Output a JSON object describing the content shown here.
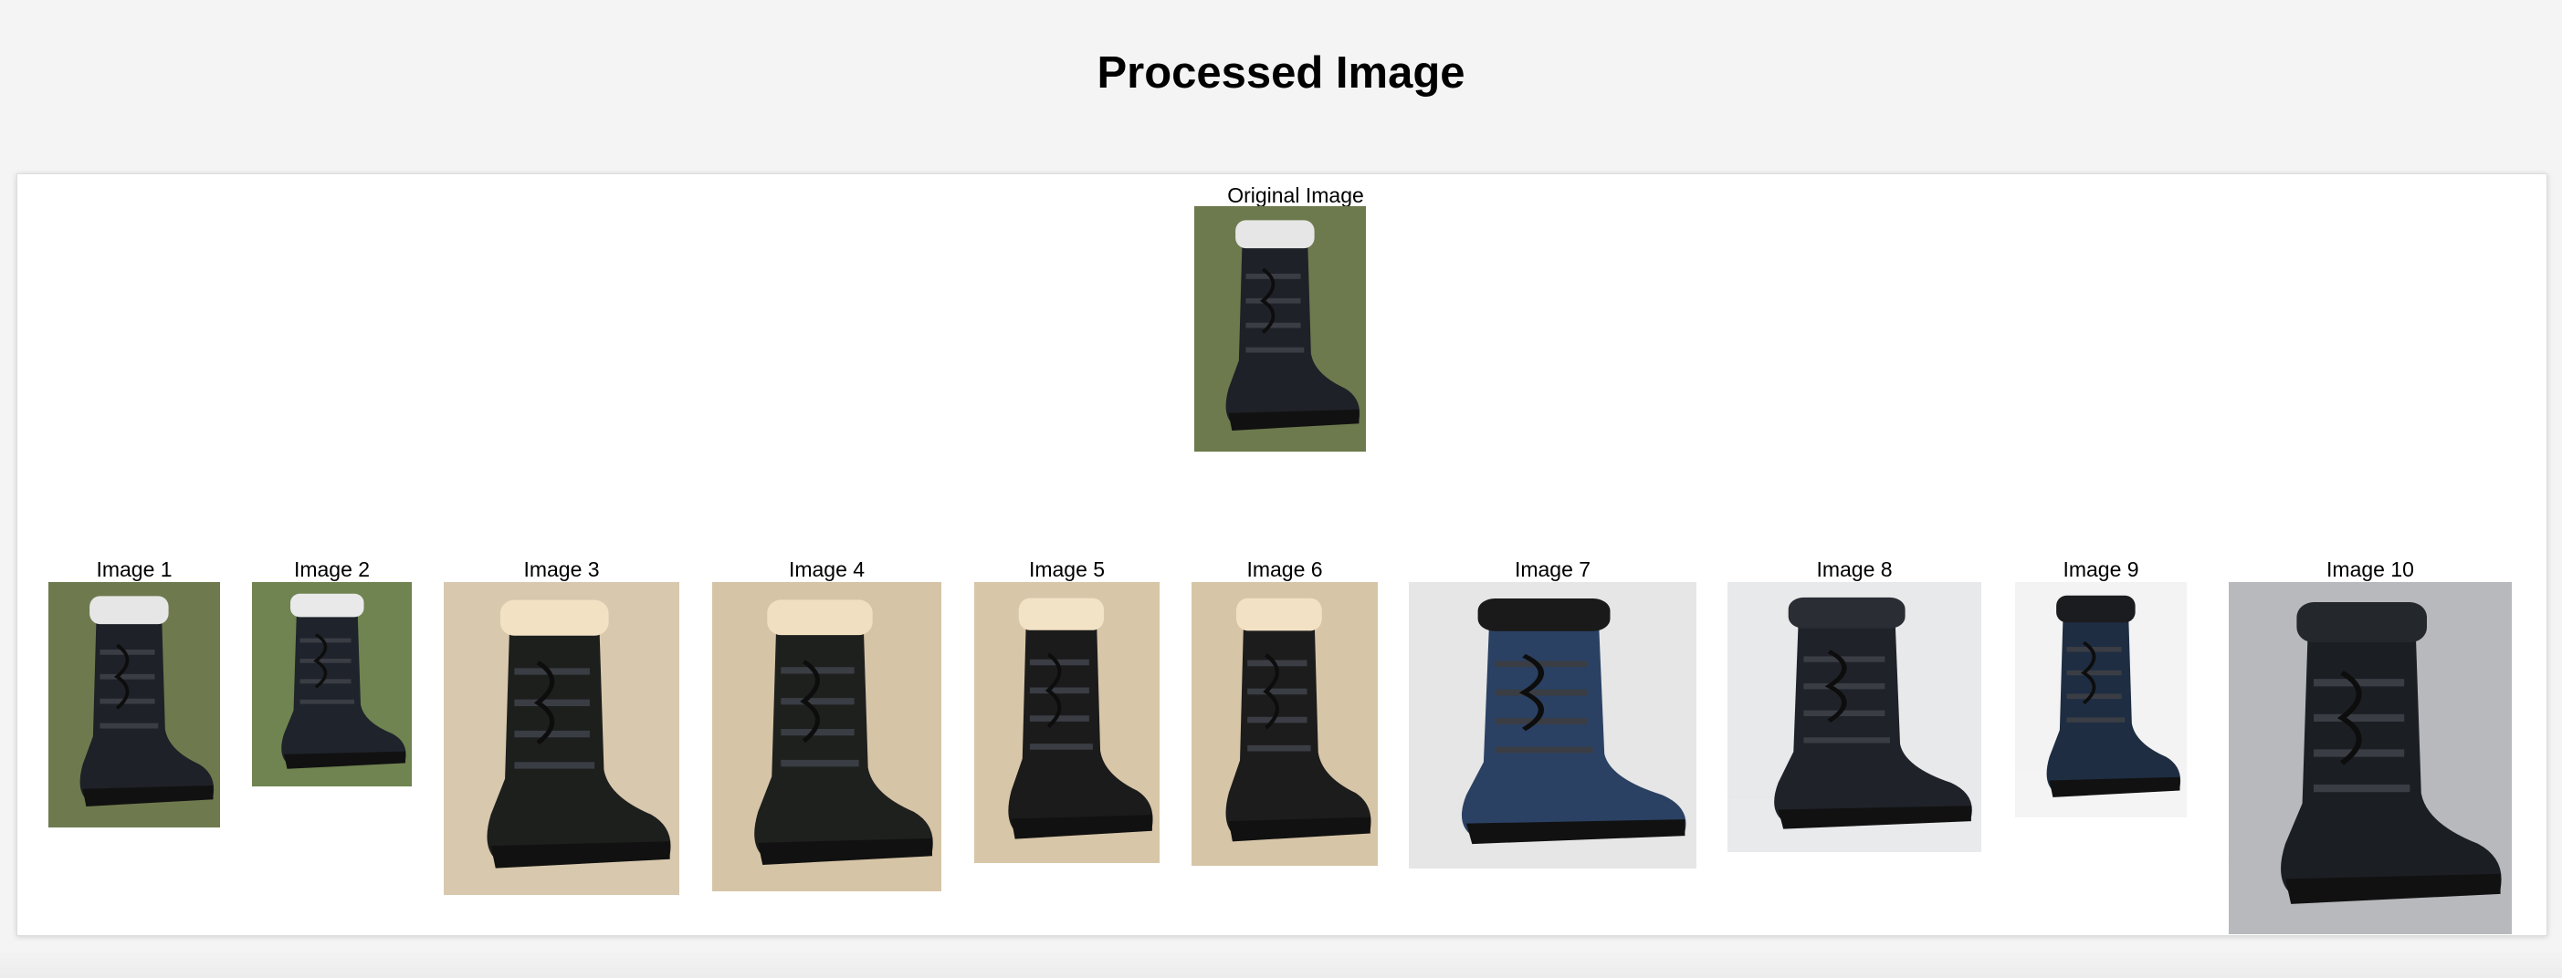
{
  "page": {
    "title": "Processed Image"
  },
  "original": {
    "caption": "Original Image",
    "icon": "boot-photo"
  },
  "results": [
    {
      "caption": "Image 1",
      "bg": "#6e7a4e",
      "boot": "#1e2127",
      "fur": "#e6e6e6",
      "icon": "boot-photo"
    },
    {
      "caption": "Image 2",
      "bg": "#6f8450",
      "boot": "#1f232b",
      "fur": "#e9e9e9",
      "icon": "boot-photo"
    },
    {
      "caption": "Image 3",
      "bg": "#d8c8ad",
      "boot": "#1d1f1d",
      "fur": "#f2e1c3",
      "icon": "boot-photo"
    },
    {
      "caption": "Image 4",
      "bg": "#d6c4a6",
      "boot": "#1e201e",
      "fur": "#f1dfc1",
      "icon": "boot-photo"
    },
    {
      "caption": "Image 5",
      "bg": "#d8c6a8",
      "boot": "#1b1b1b",
      "fur": "#f2e2c6",
      "icon": "boot-photo"
    },
    {
      "caption": "Image 6",
      "bg": "#d7c5a7",
      "boot": "#1c1c1c",
      "fur": "#f2e1c4",
      "icon": "boot-photo"
    },
    {
      "caption": "Image 7",
      "bg": "#e6e6e6",
      "boot": "#2a4163",
      "fur": "#1a1a1a",
      "icon": "boot-photo"
    },
    {
      "caption": "Image 8",
      "bg": "#e8e9eb",
      "boot": "#1f2229",
      "fur": "#2a2d33",
      "icon": "boot-photo"
    },
    {
      "caption": "Image 9",
      "bg": "#f3f3f3",
      "boot": "#1e2d42",
      "fur": "#1a1c20",
      "icon": "boot-photo"
    },
    {
      "caption": "Image 10",
      "bg": "#b7b9bd",
      "boot": "#1b1e23",
      "fur": "#24272c",
      "icon": "boot-photo"
    }
  ]
}
